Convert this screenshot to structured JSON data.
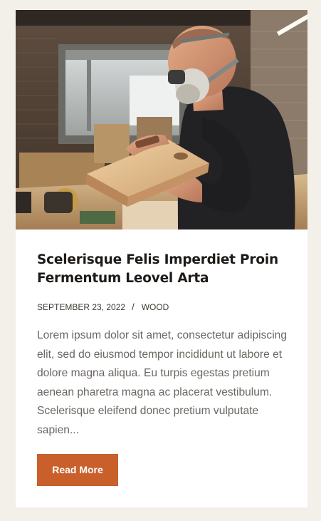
{
  "post": {
    "image_alt": "Carpenter in respirator mask inspecting a wooden piece in a workshop",
    "title": "Scelerisque Felis Imperdiet Proin Fermentum Leovel Arta",
    "date": "SEPTEMBER 23, 2022",
    "separator": "/",
    "category": "WOOD",
    "excerpt": "Lorem ipsum dolor sit amet, consectetur adipiscing elit, sed do eiusmod tempor incididunt ut labore et dolore magna aliqua. Eu turpis egestas pretium aenean pharetra magna ac placerat vestibulum. Scelerisque eleifend donec pretium vulputate sapien...",
    "read_more_label": "Read More"
  },
  "colors": {
    "page_background": "#f3f0e9",
    "card_background": "#ffffff",
    "accent": "#c9602b",
    "title": "#1d1a17",
    "body_text": "#6b6661"
  }
}
